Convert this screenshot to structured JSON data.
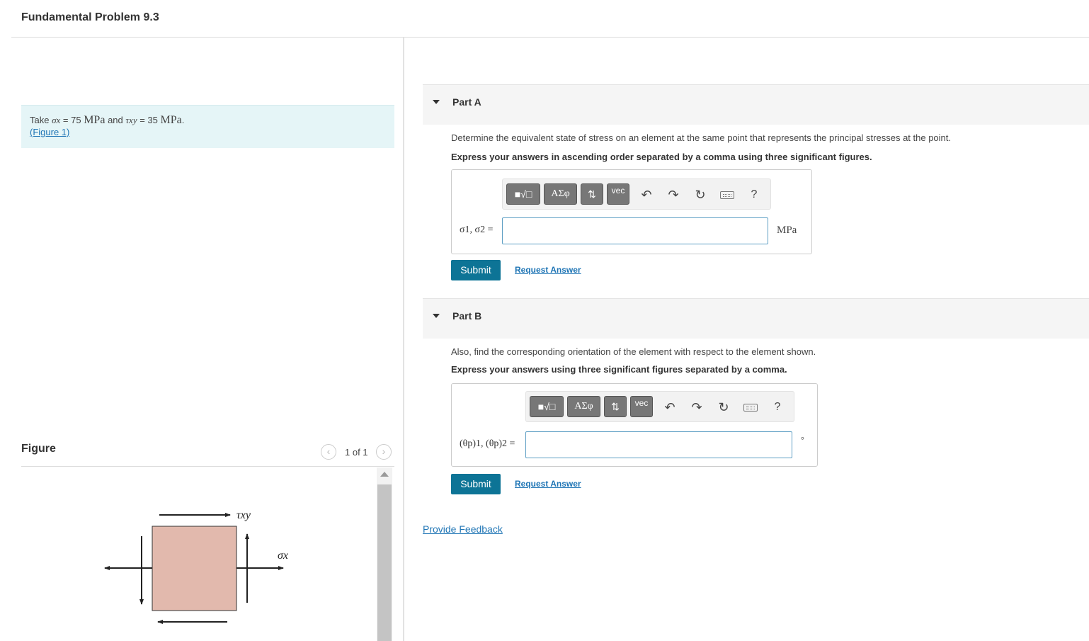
{
  "page": {
    "title": "Fundamental Problem 9.3"
  },
  "given": {
    "take": "Take",
    "sigma_sym": "σx",
    "sigma_value": "= 75",
    "unit1": "MPa",
    "and": "and",
    "tau_sym": "τxy",
    "tau_value": "= 35",
    "unit2": "MPa",
    "period": ".",
    "figure_link": "(Figure 1)"
  },
  "figure_panel": {
    "label": "Figure",
    "counter": "1 of 1",
    "prev_glyph": "‹",
    "next_glyph": "›",
    "labels": {
      "tau": "τxy",
      "sigma": "σx"
    }
  },
  "toolbar": {
    "template": "■√□",
    "greek": "ΑΣφ",
    "arrows": "⇅",
    "vec": "vec",
    "undo": "↶",
    "redo": "↷",
    "reset": "↻",
    "help": "?"
  },
  "partA": {
    "title": "Part A",
    "question": "Determine the equivalent state of stress on an element at the same point that represents the principal stresses at the point.",
    "instruction": "Express your answers in ascending order separated by a comma using three significant figures.",
    "eq_label": "σ1, σ2 =",
    "input_value": "",
    "unit": "MPa",
    "submit": "Submit",
    "request": "Request Answer"
  },
  "partB": {
    "title": "Part B",
    "question": "Also, find the corresponding orientation of the element with respect to the element shown.",
    "instruction": "Express your answers using three significant figures separated by a comma.",
    "eq_label": "(θp)1, (θp)2 =",
    "input_value": "",
    "unit": "°",
    "submit": "Submit",
    "request": "Request Answer"
  },
  "feedback": "Provide Feedback",
  "colors": {
    "accent": "#0d7496",
    "link": "#1f75b5",
    "given_bg": "#e5f5f7",
    "element_fill": "#e2b9ad"
  }
}
